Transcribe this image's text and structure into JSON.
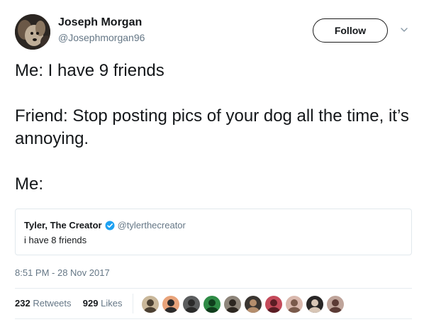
{
  "author": {
    "name": "Joseph Morgan",
    "handle": "@Josephmorgan96",
    "avatar_icon": "dog-photo-avatar"
  },
  "follow_button": {
    "label": "Follow"
  },
  "menu_icon": "chevron-down-icon",
  "tweet": {
    "paragraphs": [
      "Me: I have 9 friends",
      "Friend: Stop posting pics of your dog all the time, it’s annoying.",
      "Me:"
    ]
  },
  "quoted_tweet": {
    "author_name": "Tyler, The Creator",
    "verified_icon": "verified-badge-icon",
    "handle": "@tylerthecreator",
    "text": "i have 8 friends"
  },
  "timestamp": "8:51 PM - 28 Nov 2017",
  "stats": {
    "retweets_count": "232",
    "retweets_label": "Retweets",
    "likes_count": "929",
    "likes_label": "Likes"
  },
  "colors": {
    "text_primary": "#14171a",
    "text_secondary": "#657786",
    "verified_blue": "#1da1f2",
    "border": "#e1e8ed"
  },
  "liker_avatars": [
    {
      "color": "#c9b79a",
      "accent": "#4b4032"
    },
    {
      "color": "#e8a37a",
      "accent": "#2b2a2a"
    },
    {
      "color": "#5b5d5e",
      "accent": "#2a2a2a"
    },
    {
      "color": "#2f8b46",
      "accent": "#0f3d1c"
    },
    {
      "color": "#8d8479",
      "accent": "#2c2620"
    },
    {
      "color": "#3a3531",
      "accent": "#b58e6d"
    },
    {
      "color": "#c44a5a",
      "accent": "#5a1d24"
    },
    {
      "color": "#d9b8ad",
      "accent": "#7a5a4b"
    },
    {
      "color": "#282626",
      "accent": "#d8c6b6"
    },
    {
      "color": "#bfa49a",
      "accent": "#5b3b35"
    }
  ]
}
